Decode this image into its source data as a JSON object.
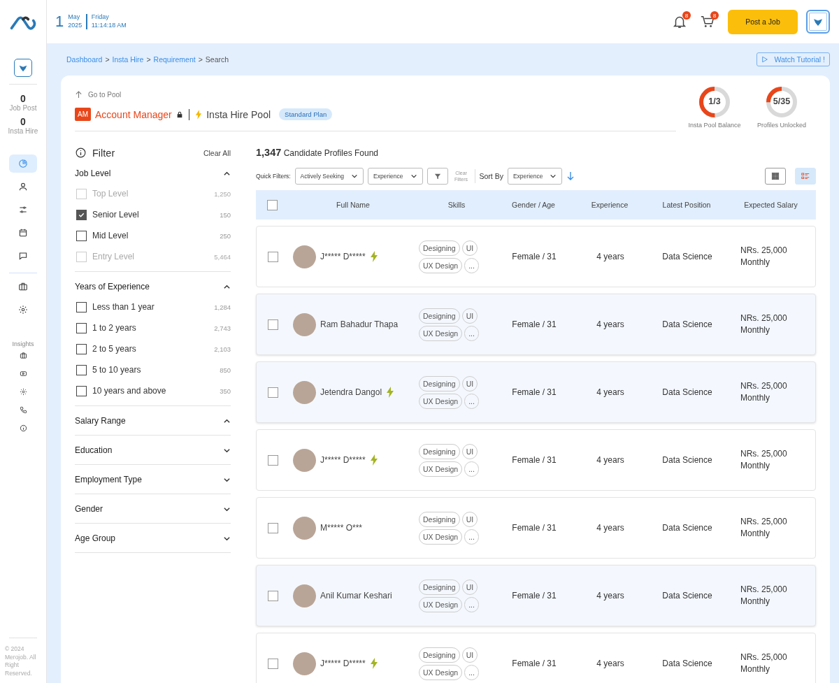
{
  "topbar": {
    "date": {
      "day": "1",
      "month": "May",
      "year": "2025",
      "weekday": "Friday",
      "time": "11:14:18 AM"
    },
    "notifications": {
      "count": "8"
    },
    "cart": {
      "count": "8"
    },
    "post_button": "Post a Job"
  },
  "sidebar": {
    "stats": [
      {
        "value": "0",
        "label": "Job Post"
      },
      {
        "value": "0",
        "label": "Insta Hire"
      }
    ],
    "nav": [
      {
        "kind": "pie",
        "selected": true
      },
      {
        "kind": "user",
        "selected": false
      },
      {
        "kind": "sliders",
        "selected": false
      },
      {
        "kind": "calendar",
        "selected": false
      },
      {
        "kind": "chat",
        "selected": false
      }
    ],
    "tools": [
      {
        "kind": "briefcase",
        "selected": false
      },
      {
        "kind": "gear",
        "selected": false
      }
    ],
    "insights_label": "Insights",
    "insights": [
      {
        "kind": "briefcase"
      },
      {
        "kind": "video"
      },
      {
        "kind": "gear"
      },
      {
        "kind": "phone"
      },
      {
        "kind": "info"
      }
    ],
    "footer": "© 2024 Merojob. All Right Reserved."
  },
  "breadcrumb": {
    "separator": ">",
    "items": [
      {
        "label": "Dashboard",
        "link": true
      },
      {
        "label": "Insta Hire",
        "link": true
      },
      {
        "label": "Requirement",
        "link": true
      },
      {
        "label": "Search",
        "link": false
      }
    ]
  },
  "tutorial_button": "Watch Tutorial !",
  "header": {
    "back_link": "Go to Pool",
    "initials": "AM",
    "title": "Account Manager",
    "locked": true,
    "pool": "Insta Hire Pool",
    "plan": "Standard Plan"
  },
  "stats": [
    {
      "reading": "1/3",
      "label": "Insta Pool Balance",
      "level": 0.5
    },
    {
      "reading": "5/35",
      "label": "Profiles Unlocked",
      "level": 0.25
    }
  ],
  "filter": {
    "title": "Filter",
    "clear": "Clear All",
    "sections": [
      {
        "title": "Job Level",
        "expanded": true,
        "options": [
          {
            "label": "Top Level",
            "count": "1,250",
            "checked": false,
            "disabled": true
          },
          {
            "label": "Senior Level",
            "count": "150",
            "checked": true,
            "disabled": false
          },
          {
            "label": "Mid Level",
            "count": "250",
            "checked": false,
            "disabled": false
          },
          {
            "label": "Entry Level",
            "count": "5,464",
            "checked": false,
            "disabled": true
          }
        ]
      },
      {
        "title": "Years of Experience",
        "expanded": true,
        "options": [
          {
            "label": "Less than 1 year",
            "count": "1,284",
            "checked": false,
            "disabled": false
          },
          {
            "label": "1 to 2 years",
            "count": "2,743",
            "checked": false,
            "disabled": false
          },
          {
            "label": "2 to 5 years",
            "count": "2,103",
            "checked": false,
            "disabled": false
          },
          {
            "label": "5 to 10 years",
            "count": "850",
            "checked": false,
            "disabled": false
          },
          {
            "label": "10 years and above",
            "count": "350",
            "checked": false,
            "disabled": false
          }
        ]
      },
      {
        "title": "Salary Range",
        "expanded": true
      },
      {
        "title": "Education",
        "expanded": false
      },
      {
        "title": "Employment Type",
        "expanded": false
      },
      {
        "title": "Gender",
        "expanded": false
      },
      {
        "title": "Age Group",
        "expanded": false
      }
    ]
  },
  "results": {
    "summary": "**1,347** Candidate Profiles Found",
    "quick_label": "Quick Filters:",
    "quick_filters": [
      "Actively Seeking",
      "Experience"
    ],
    "clear_filters": "Clear Filters",
    "sort_label": "Sort By",
    "sort_value": "Experience",
    "views": [
      {
        "kind": "grid",
        "selected": false
      },
      {
        "kind": "list",
        "selected": true
      }
    ]
  },
  "table": {
    "all_checked": false,
    "columns": [
      "Full Name",
      "Skills",
      "Gender / Age",
      "Experience",
      "Latest Position",
      "Expected Salary"
    ],
    "rows": [
      {
        "name": "J***** D*****",
        "insta": true,
        "unlocked": false,
        "checked": false,
        "skills": [
          "Designing",
          "UI",
          "UX Design",
          "..."
        ],
        "gender_age": "Female / 31",
        "experience": "4 years",
        "position": "Data Science",
        "salary": "NRs. 25,000 Monthly"
      },
      {
        "name": "Ram Bahadur Thapa",
        "insta": false,
        "unlocked": true,
        "checked": false,
        "skills": [
          "Designing",
          "UI",
          "UX Design",
          "..."
        ],
        "gender_age": "Female / 31",
        "experience": "4 years",
        "position": "Data Science",
        "salary": "NRs. 25,000 Monthly"
      },
      {
        "name": "Jetendra Dangol",
        "insta": true,
        "unlocked": true,
        "checked": false,
        "skills": [
          "Designing",
          "UI",
          "UX Design",
          "..."
        ],
        "gender_age": "Female / 31",
        "experience": "4 years",
        "position": "Data Science",
        "salary": "NRs. 25,000 Monthly"
      },
      {
        "name": "J***** D*****",
        "insta": true,
        "unlocked": false,
        "checked": false,
        "skills": [
          "Designing",
          "UI",
          "UX Design",
          "..."
        ],
        "gender_age": "Female / 31",
        "experience": "4 years",
        "position": "Data Science",
        "salary": "NRs. 25,000 Monthly"
      },
      {
        "name": "M***** O***",
        "insta": false,
        "unlocked": false,
        "checked": false,
        "skills": [
          "Designing",
          "UI",
          "UX Design",
          "..."
        ],
        "gender_age": "Female / 31",
        "experience": "4 years",
        "position": "Data Science",
        "salary": "NRs. 25,000 Monthly"
      },
      {
        "name": "Anil Kumar Keshari",
        "insta": false,
        "unlocked": true,
        "checked": false,
        "skills": [
          "Designing",
          "UI",
          "UX Design",
          "..."
        ],
        "gender_age": "Female / 31",
        "experience": "4 years",
        "position": "Data Science",
        "salary": "NRs. 25,000 Monthly"
      },
      {
        "name": "J***** D*****",
        "insta": true,
        "unlocked": false,
        "checked": false,
        "skills": [
          "Designing",
          "UI",
          "UX Design",
          "..."
        ],
        "gender_age": "Female / 31",
        "experience": "4 years",
        "position": "Data Science",
        "salary": "NRs. 25,000 Monthly"
      }
    ]
  }
}
